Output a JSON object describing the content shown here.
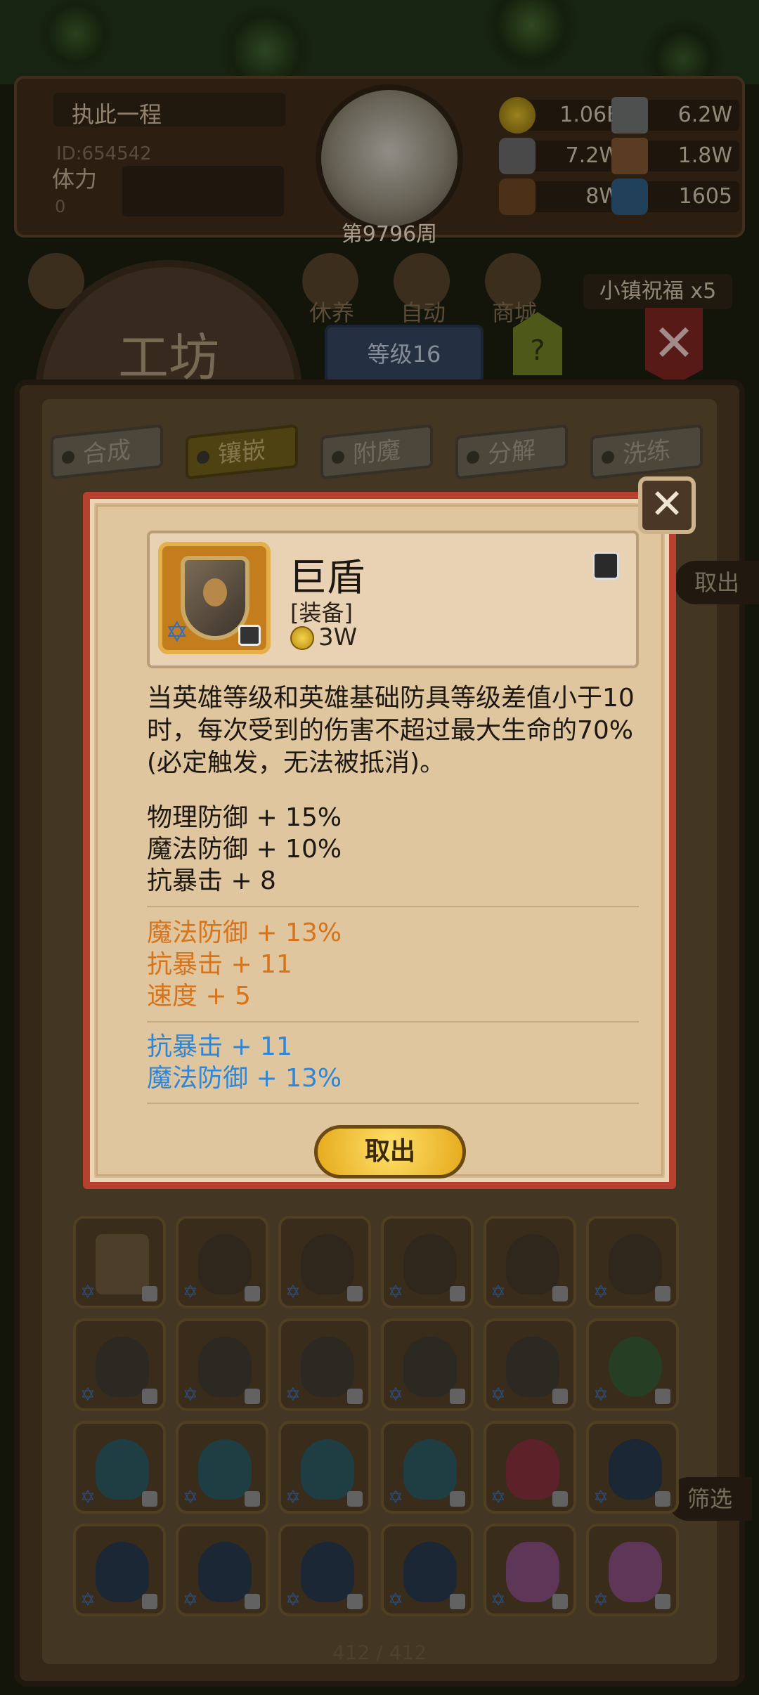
{
  "player": {
    "name": "执此一程",
    "id": "ID:654542",
    "stamina_label": "体力",
    "stamina_value": "0",
    "week": "第9796周"
  },
  "resources": [
    {
      "icon": "gold-coin-icon",
      "value": "1.06E"
    },
    {
      "icon": "iron-ingot-icon",
      "value": "6.2W"
    },
    {
      "icon": "stone-ore-icon",
      "value": "7.2W"
    },
    {
      "icon": "leather-icon",
      "value": "1.8W"
    },
    {
      "icon": "wood-log-icon",
      "value": "8W"
    },
    {
      "icon": "crystal-icon",
      "value": "1605"
    }
  ],
  "nav": {
    "workshop": "工坊",
    "rest": "休养",
    "auto": "自动",
    "shop": "商城",
    "level": "等级16",
    "help": "?",
    "blessing": "小镇祝福 x5"
  },
  "tabs": [
    "合成",
    "镶嵌",
    "附魔",
    "分解",
    "洗练"
  ],
  "active_tab": "镶嵌",
  "side_buttons": {
    "take": "取出",
    "filter": "筛选"
  },
  "item": {
    "name": "巨盾",
    "type": "[装备]",
    "price": "3W",
    "description": "当英雄等级和英雄基础防具等级差值小于10时，每次受到的伤害不超过最大生命的70%(必定触发，无法被抵消)。",
    "base_stats": [
      "物理防御 + 15%",
      "魔法防御 + 10%",
      "抗暴击 + 8"
    ],
    "enchant_stats": [
      "魔法防御 + 13%",
      "抗暴击 + 11",
      "速度 + 5"
    ],
    "gem_stats": [
      "抗暴击 + 11",
      "魔法防御 + 13%"
    ],
    "take_button": "取出"
  },
  "inventory_count": "412 / 412",
  "colors": {
    "orange_stat": "#d5741b",
    "blue_stat": "#2f86d6",
    "modal_border": "#b7402e"
  }
}
